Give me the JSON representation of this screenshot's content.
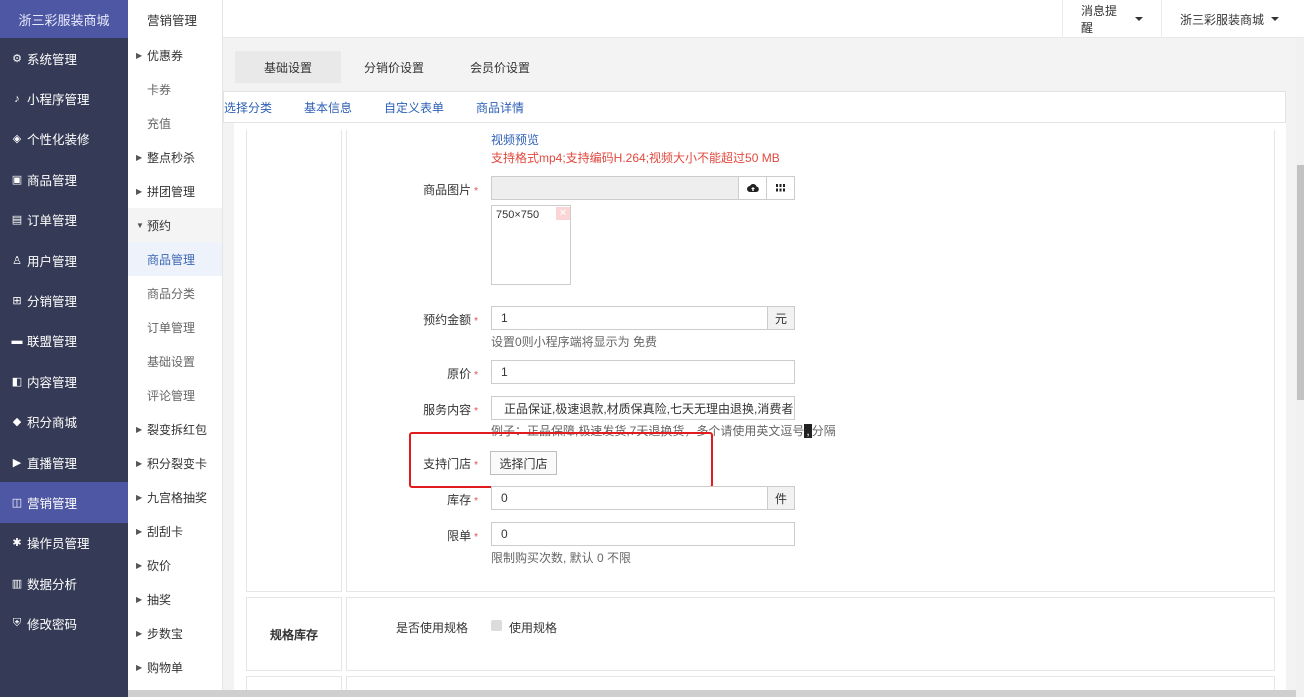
{
  "brand": "浙三彩服装商城",
  "sidebar": {
    "items": [
      {
        "label": "系统管理",
        "icon": "gear-icon",
        "glyph": "⚙"
      },
      {
        "label": "小程序管理",
        "icon": "link-icon",
        "glyph": "♪"
      },
      {
        "label": "个性化装修",
        "icon": "diamond-icon",
        "glyph": "◈"
      },
      {
        "label": "商品管理",
        "icon": "bag-icon",
        "glyph": "▣"
      },
      {
        "label": "订单管理",
        "icon": "clipboard-icon",
        "glyph": "▤"
      },
      {
        "label": "用户管理",
        "icon": "user-icon",
        "glyph": "♙"
      },
      {
        "label": "分销管理",
        "icon": "sitemap-icon",
        "glyph": "⊞"
      },
      {
        "label": "联盟管理",
        "icon": "card-icon",
        "glyph": "▬"
      },
      {
        "label": "内容管理",
        "icon": "content-icon",
        "glyph": "◧"
      },
      {
        "label": "积分商城",
        "icon": "box-icon",
        "glyph": "◆"
      },
      {
        "label": "直播管理",
        "icon": "play-icon",
        "glyph": "▶"
      },
      {
        "label": "营销管理",
        "icon": "marketing-icon",
        "glyph": "◫"
      },
      {
        "label": "操作员管理",
        "icon": "cog-icon",
        "glyph": "✱"
      },
      {
        "label": "数据分析",
        "icon": "bar-chart-icon",
        "glyph": "▥"
      },
      {
        "label": "修改密码",
        "icon": "shield-icon",
        "glyph": "⛨"
      }
    ],
    "active_index": 11
  },
  "subbar": {
    "title": "营销管理",
    "items": [
      {
        "label": "优惠券",
        "type": "group"
      },
      {
        "label": "卡券",
        "type": "child"
      },
      {
        "label": "充值",
        "type": "child"
      },
      {
        "label": "整点秒杀",
        "type": "group"
      },
      {
        "label": "拼团管理",
        "type": "group"
      },
      {
        "label": "预约",
        "type": "open"
      },
      {
        "label": "商品管理",
        "type": "current"
      },
      {
        "label": "商品分类",
        "type": "child"
      },
      {
        "label": "订单管理",
        "type": "child"
      },
      {
        "label": "基础设置",
        "type": "child"
      },
      {
        "label": "评论管理",
        "type": "child"
      },
      {
        "label": "裂变拆红包",
        "type": "group"
      },
      {
        "label": "积分裂变卡",
        "type": "group"
      },
      {
        "label": "九宫格抽奖",
        "type": "group"
      },
      {
        "label": "刮刮卡",
        "type": "group"
      },
      {
        "label": "砍价",
        "type": "group"
      },
      {
        "label": "抽奖",
        "type": "group"
      },
      {
        "label": "步数宝",
        "type": "group"
      },
      {
        "label": "购物单",
        "type": "group"
      }
    ]
  },
  "topbar": {
    "notify": "消息提醒",
    "shop": "浙三彩服装商城"
  },
  "tabs": [
    "基础设置",
    "分销价设置",
    "会员价设置"
  ],
  "subtabs": [
    "选择分类",
    "基本信息",
    "自定义表单",
    "商品详情"
  ],
  "form": {
    "video_preview": "视频预览",
    "video_hint": "支持格式mp4;支持编码H.264;视频大小不能超过50 MB",
    "images_label": "商品图片",
    "image_size": "750×750",
    "deposit_label": "预约金额",
    "deposit_value": "1",
    "deposit_unit": "元",
    "deposit_hint": "设置0则小程序端将显示为 免费",
    "price_label": "原价",
    "price_value": "1",
    "service_label": "服务内容",
    "service_value": "正品保证,极速退款,材质保真险,七天无理由退换,消费者",
    "service_hint": "例子：正品保障,极速发货,7天退换货，多个请使用英文逗号",
    "service_hint_comma": ",",
    "service_hint_tail": "分隔",
    "store_label": "支持门店",
    "store_button": "选择门店",
    "stock_label": "库存",
    "stock_value": "0",
    "stock_unit": "件",
    "limit_label": "限单",
    "limit_value": "0",
    "limit_hint": "限制购买次数, 默认 0 不限",
    "required_mark": "*"
  },
  "spec": {
    "section_title": "规格库存",
    "use_spec_label": "是否使用规格",
    "use_spec_option": "使用规格"
  }
}
